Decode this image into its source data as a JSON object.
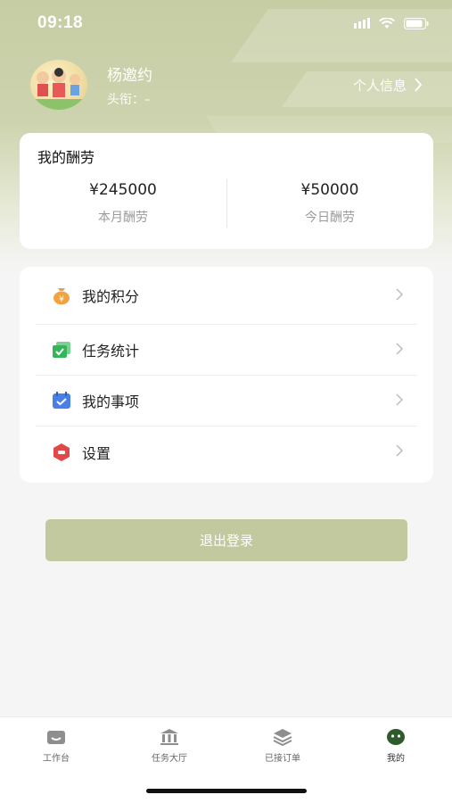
{
  "status_bar": {
    "time": "09:18"
  },
  "profile": {
    "name": "杨邀约",
    "title": "头衔：–",
    "personal_info_label": "个人信息"
  },
  "salary": {
    "title": "我的酬劳",
    "month_amount": "¥245000",
    "month_label": "本月酬劳",
    "today_amount": "¥50000",
    "today_label": "今日酬劳"
  },
  "menu": {
    "items": [
      {
        "label": "我的积分",
        "icon": "money-bag-icon"
      },
      {
        "label": "任务统计",
        "icon": "statistics-icon"
      },
      {
        "label": "我的事项",
        "icon": "calendar-check-icon"
      },
      {
        "label": "设置",
        "icon": "settings-hexagon-icon"
      }
    ]
  },
  "logout_label": "退出登录",
  "tabbar": {
    "tabs": [
      {
        "label": "工作台",
        "icon": "workbench-icon"
      },
      {
        "label": "任务大厅",
        "icon": "hall-icon"
      },
      {
        "label": "已接订单",
        "icon": "layers-icon"
      },
      {
        "label": "我的",
        "icon": "profile-face-icon"
      }
    ],
    "active": "我的"
  },
  "colors": {
    "accent": "#c3c99e",
    "header": "#c6cda4",
    "active_tab": "#2f5a2c"
  }
}
